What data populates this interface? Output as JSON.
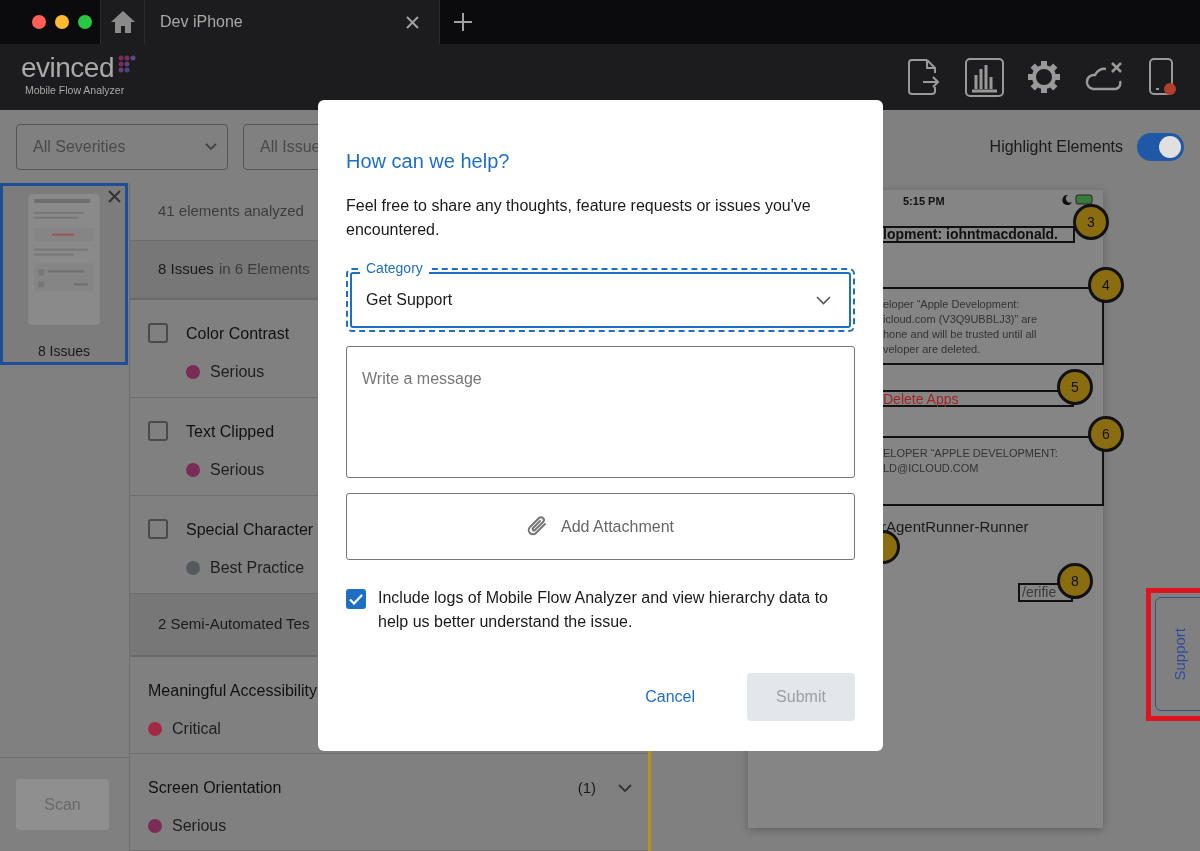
{
  "window": {
    "tabs": [
      {
        "label": "Dev iPhone",
        "selected": true
      }
    ]
  },
  "header": {
    "logo": "evinced",
    "subtitle": "Mobile Flow Analyzer"
  },
  "filters": [
    {
      "value": "All Severities"
    },
    {
      "value": "All Issue"
    }
  ],
  "highlight": {
    "label": "Highlight Elements",
    "on": true
  },
  "screens": [
    {
      "label": "8 Issues",
      "selected": true
    }
  ],
  "summary": {
    "analyzed": "41 elements analyzed",
    "count": "8 Issues",
    "scope": "in 6 Elements"
  },
  "issues": [
    {
      "title": "Color Contrast",
      "severity": "Serious",
      "color": "#7a2c57",
      "checked": false
    },
    {
      "title": "Text Clipped",
      "severity": "Serious",
      "color": "#7a2c57",
      "checked": false
    },
    {
      "title": "Special Character",
      "severity": "Best Practice",
      "color": "#55595f",
      "checked": false
    }
  ],
  "semi_automated": "2 Semi-Automated Tes",
  "tests": [
    {
      "title": "Meaningful Accessibility",
      "severity": "Critical",
      "color": "#a32a45"
    },
    {
      "title": "Screen Orientation",
      "count": "(1)",
      "severity": "Serious",
      "color": "#7a2c57"
    }
  ],
  "scan_button": {
    "label": "Scan",
    "disabled": true
  },
  "device_screen": {
    "time": "5:15 PM",
    "elements": [
      {
        "kind": "line",
        "number": "3",
        "texts": [
          "lopment: iohntmacdonald."
        ]
      },
      {
        "kind": "block",
        "number": "4",
        "texts": [
          "eloper “Apple Development:",
          "icloud.com (V3Q9UBBLJ3)” are",
          "hone and will be trusted until all",
          "veloper are deleted."
        ]
      },
      {
        "kind": "danger",
        "number": "5",
        "texts": [
          "Delete Apps"
        ]
      },
      {
        "kind": "block",
        "number": "6",
        "texts": [
          "ELOPER “APPLE DEVELOPMENT:",
          "LD@ICLOUD.COM"
        ]
      },
      {
        "kind": "plain",
        "texts": [
          "rAgentRunner-Runner"
        ]
      },
      {
        "kind": "tag",
        "number": "8",
        "texts": [
          "/erifie"
        ]
      }
    ]
  },
  "support_tab": "Support",
  "dialog": {
    "title": "How can we help?",
    "description": "Feel free to share any thoughts, feature requests or issues you've encountered.",
    "category": {
      "label": "Category",
      "value": "Get Support"
    },
    "message": {
      "placeholder": "Write a message"
    },
    "attachment": "Add Attachment",
    "include_logs": {
      "label": "Include logs of Mobile Flow Analyzer and view hierarchy data to help us better understand the issue.",
      "checked": true
    },
    "buttons": [
      {
        "kind": "link",
        "label": "Cancel",
        "disabled": false
      },
      {
        "kind": "primary",
        "label": "Submit",
        "disabled": true
      }
    ]
  }
}
